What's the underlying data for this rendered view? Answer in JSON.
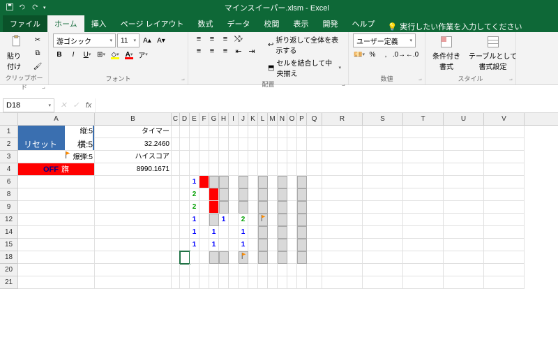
{
  "title": "マインスイーパー.xlsm - Excel",
  "tabs": {
    "file": "ファイル",
    "home": "ホーム",
    "insert": "挿入",
    "layout": "ページ レイアウト",
    "formulas": "数式",
    "data": "データ",
    "review": "校閲",
    "view": "表示",
    "developer": "開発",
    "help": "ヘルプ"
  },
  "tellme": "実行したい作業を入力してください",
  "ribbon": {
    "clipboard": {
      "paste": "貼り付け",
      "label": "クリップボード"
    },
    "font": {
      "name": "游ゴシック",
      "size": "11",
      "label": "フォント"
    },
    "align": {
      "wrap": "折り返して全体を表示する",
      "merge": "セルを結合して中央揃え",
      "label": "配置"
    },
    "number": {
      "format": "ユーザー定義",
      "label": "数値"
    },
    "styles": {
      "cond": "条件付き\n書式",
      "table": "テーブルとして\n書式設定",
      "label": "スタイル"
    }
  },
  "namebox": "D18",
  "cols": [
    "A",
    "B",
    "C",
    "D",
    "E",
    "F",
    "G",
    "H",
    "I",
    "J",
    "K",
    "L",
    "M",
    "N",
    "O",
    "P",
    "Q",
    "R",
    "S",
    "T",
    "U",
    "V"
  ],
  "rowLabels": [
    "1",
    "2",
    "3",
    "4",
    "6",
    "8",
    "9",
    "12",
    "14",
    "15",
    "18",
    "20",
    "21"
  ],
  "sheet": {
    "reset": "リセット",
    "off": "OFF",
    "flag_label": "旗",
    "a1": "縦:5",
    "a2": "横:5",
    "a3": "爆弾:5",
    "b1": "タイマー",
    "b2": "32.2460",
    "b3": "ハイスコア",
    "b4": "8990.1671"
  },
  "mine": {
    "r6": [
      "",
      "1",
      "R",
      "T",
      "T",
      "",
      "T",
      "",
      "T",
      "",
      "T",
      "",
      "T"
    ],
    "r8": [
      "",
      "2",
      "",
      "R",
      "T",
      "",
      "T",
      "",
      "T",
      "",
      "T",
      "",
      "T"
    ],
    "r12": [
      "",
      "1",
      "",
      "T",
      "1",
      "",
      "2",
      "",
      "F",
      "",
      "T",
      "",
      "T"
    ],
    "r14": [
      "",
      "1",
      "",
      "1",
      "",
      "",
      "1",
      "",
      "T",
      "",
      "T",
      "",
      "T"
    ],
    "r18": [
      "O",
      "O",
      "",
      "T",
      "T",
      "",
      "F",
      "",
      "T",
      "",
      "T",
      "",
      "T"
    ]
  }
}
